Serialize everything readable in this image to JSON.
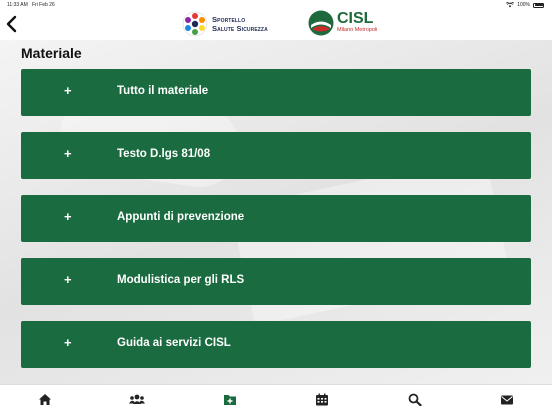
{
  "status_bar": {
    "time": "11:33 AM",
    "date": "Fri Feb 26",
    "battery": "100%",
    "icons": [
      "wifi-icon",
      "battery-icon"
    ]
  },
  "header": {
    "back_icon": "chevron-left-icon",
    "logo_sportello": {
      "line1": "Sportello",
      "line2": "Salute Sicurezza"
    },
    "logo_cisl": {
      "brand": "CISL",
      "subtitle": "Milano Metropoli"
    }
  },
  "page": {
    "title": "Materiale",
    "items": [
      {
        "icon": "+",
        "label": "Tutto il materiale"
      },
      {
        "icon": "+",
        "label": "Testo D.lgs 81/08"
      },
      {
        "icon": "+",
        "label": "Appunti di prevenzione"
      },
      {
        "icon": "+",
        "label": "Modulistica per gli RLS"
      },
      {
        "icon": "+",
        "label": "Guida ai servizi CISL"
      }
    ]
  },
  "tab_bar": [
    {
      "name": "home",
      "icon": "home-icon",
      "active": false
    },
    {
      "name": "people",
      "icon": "users-icon",
      "active": false
    },
    {
      "name": "material",
      "icon": "folder-plus-icon",
      "active": true
    },
    {
      "name": "calendar",
      "icon": "calendar-icon",
      "active": false
    },
    {
      "name": "search",
      "icon": "search-icon",
      "active": false
    },
    {
      "name": "mail",
      "icon": "envelope-icon",
      "active": false
    }
  ],
  "colors": {
    "accent_green": "#1b6b41",
    "tab_icon": "#222222",
    "active_tab_icon": "#1b6b41",
    "cisl_red": "#c92a2a"
  }
}
